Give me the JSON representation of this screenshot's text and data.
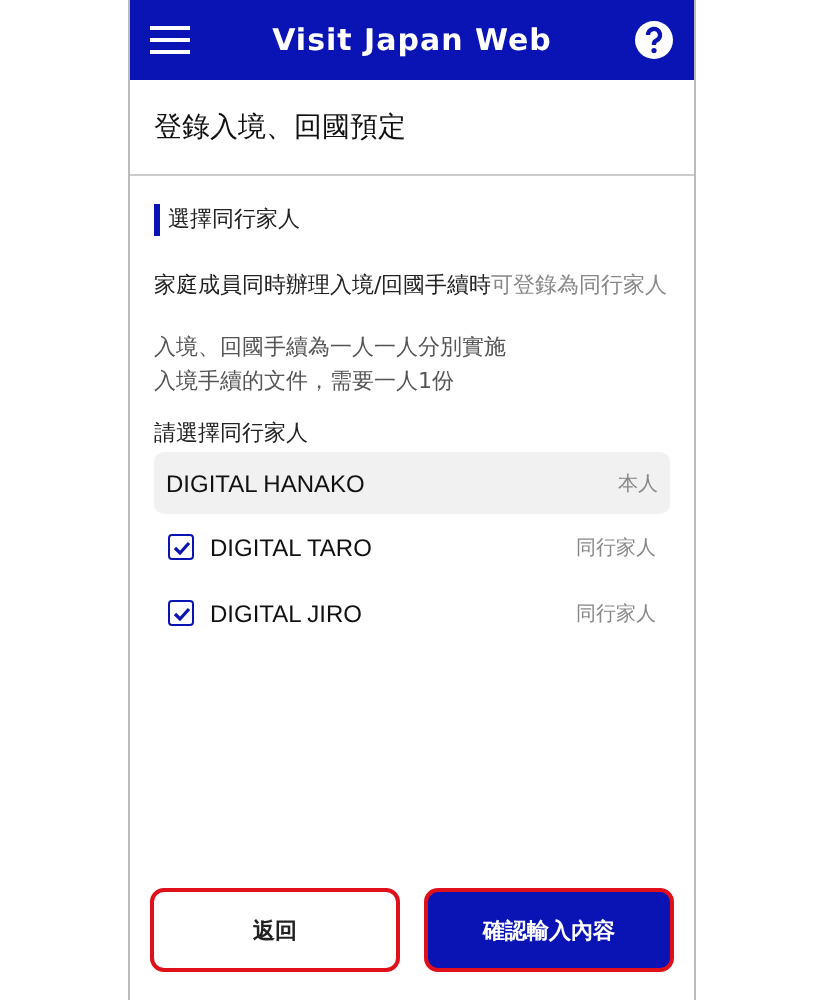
{
  "header": {
    "title": "Visit Japan Web"
  },
  "page_title": "登錄入境、回國預定",
  "section_title": "選擇同行家人",
  "description": "**家庭成員同時辦理入境/回國手續時**可登錄為同行家人",
  "note_lines": [
    "入境、回國手續為一人一人分別實施",
    "入境手續的文件，需要一人1份"
  ],
  "select_label": "請選擇同行家人",
  "members": [
    {
      "kind": "self",
      "name": "DIGITAL HANAKO",
      "role": "本人"
    },
    {
      "kind": "companion",
      "name": "DIGITAL TARO",
      "role": "同行家人",
      "checked": true
    },
    {
      "kind": "companion",
      "name": "DIGITAL JIRO",
      "role": "同行家人",
      "checked": true
    }
  ],
  "buttons": [
    {
      "kind": "secondary",
      "label": "返回",
      "highlighted": true
    },
    {
      "kind": "primary",
      "label": "確認輸入內容",
      "highlighted": true
    }
  ]
}
